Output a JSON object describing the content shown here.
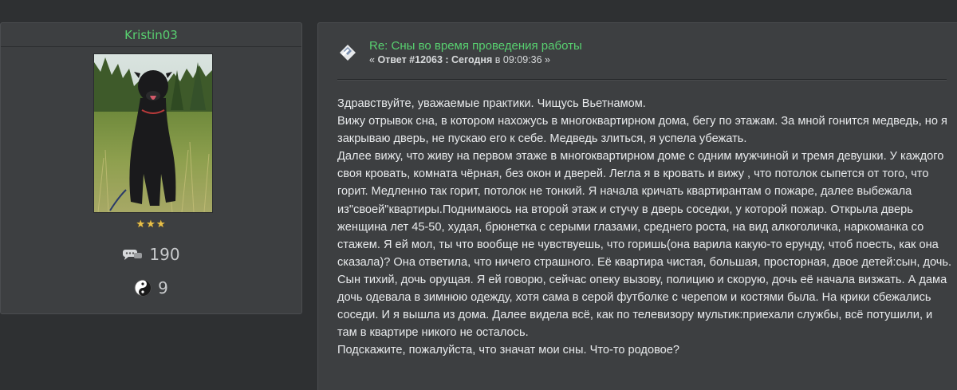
{
  "author": {
    "name": "Kristin03",
    "rank_stars": "★★★",
    "post_count": "190",
    "karma": "9",
    "avatar_icon": "dog-photo",
    "posts_icon": "speech-bubble-icon",
    "karma_icon": "yin-yang-icon"
  },
  "post": {
    "icon": "message-icon",
    "title": "Re: Сны во время проведения работы",
    "meta_prefix": "« ",
    "meta_reply": "Ответ #12063 :",
    "meta_today": " Сегодня",
    "meta_time": " в 09:09:36 »",
    "body": [
      "Здравствуйте, уважаемые практики. Чищусь Вьетнамом.",
      "Вижу отрывок сна, в котором нахожусь в многоквартирном дома, бегу по этажам. За мной гонится медведь, но я закрываю дверь, не пускаю его к себе. Медведь злиться, я успела убежать.",
      "Далее вижу, что живу на первом этаже в многоквартирном доме с одним мужчиной и тремя девушки. У каждого своя кровать, комната чёрная, без окон и дверей. Легла я в кровать и вижу , что потолок сыпется от того, что горит. Медленно так горит, потолок не тонкий. Я начала кричать квартирантам о пожаре, далее выбежала из\"своей\"квартиры.Поднимаюсь на второй этаж и стучу в дверь соседки, у которой пожар. Открыла дверь женщина лет 45-50, худая, брюнетка с серыми глазами, среднего роста, на вид алкоголичка, наркоманка со стажем. Я ей мол, ты что вообще не чувствуешь, что горишь(она варила какую-то ерунду, чтоб поесть, как она сказала)? Она ответила, что ничего страшного. Её квартира чистая, большая, просторная, двое детей:сын, дочь. Сын тихий, дочь орущая. Я ей говорю, сейчас опеку вызову, полицию и скорую, дочь её начала визжать. А дама дочь одевала в зимнюю одежду, хотя сама в серой футболке с черепом и костями была. На крики сбежались соседи. И я вышла из дома. Далее видела всё, как по телевизору мультик:приехали службы, всё потушили, и там в квартире никого не осталось.",
      "Подскажите, пожалуйста, что значат мои сны. Что-то родовое?"
    ]
  },
  "colors": {
    "background": "#2e3032",
    "panel": "#3d3f41",
    "accent_green": "#58d070",
    "text": "#e8eaec"
  }
}
